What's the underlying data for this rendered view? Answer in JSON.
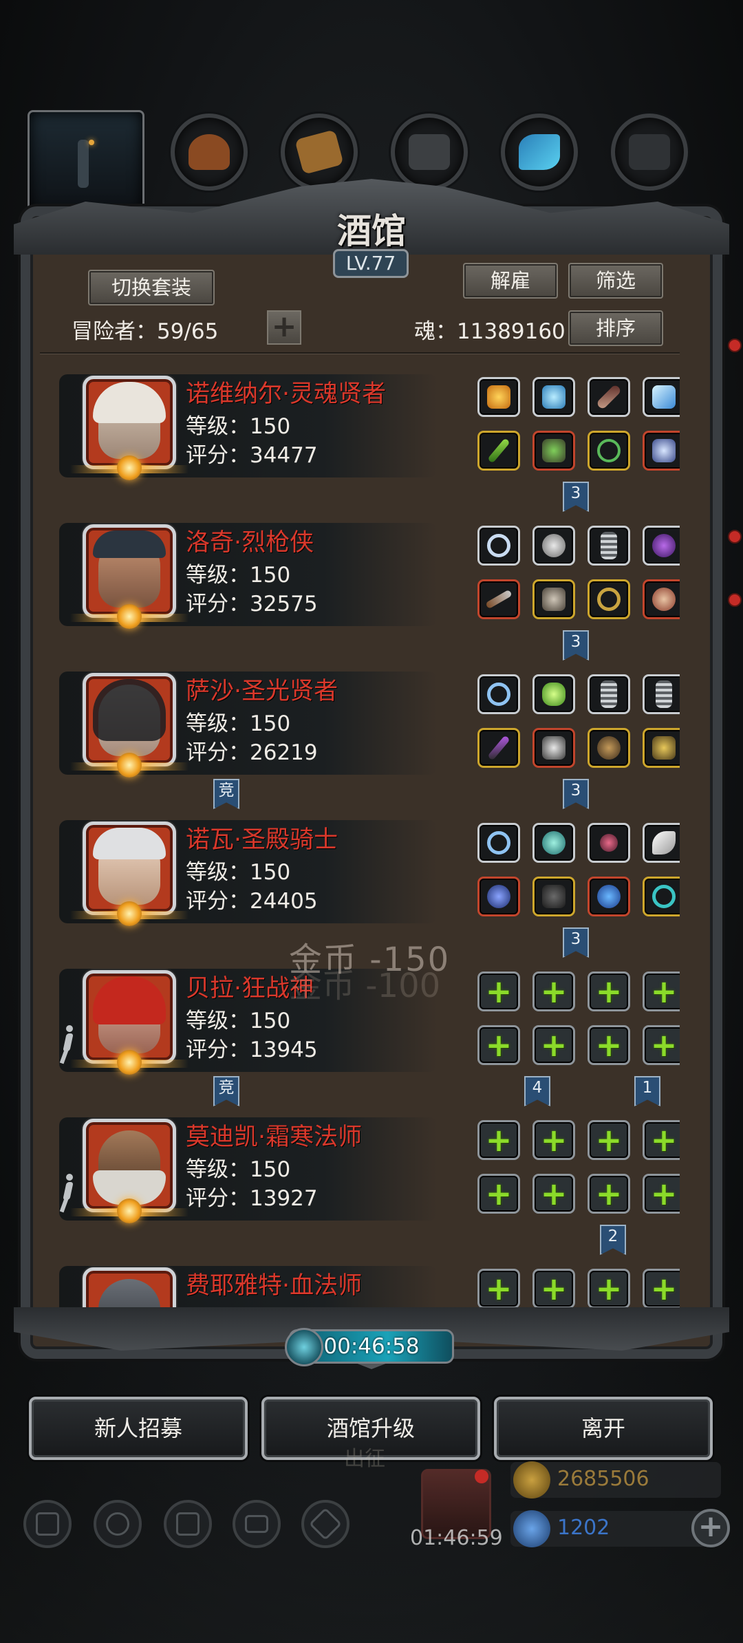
{
  "title": "酒馆",
  "level_badge": "LV.77",
  "buttons": {
    "switch_outfit": "切换套装",
    "dismiss": "解雇",
    "filter": "筛选",
    "sort": "排序",
    "recruit": "新人招募",
    "upgrade": "酒馆升级",
    "leave": "离开"
  },
  "adventurers": "冒险者：59/65",
  "plus": "+",
  "soul": "魂：11389160",
  "floating_text": "金币 -150",
  "floating_text_ghost": "金币 -100",
  "timer": "00:46:58",
  "heroes": [
    {
      "name": "诺维纳尔·灵魂贤者",
      "level": "等级：150",
      "score": "评分：34477"
    },
    {
      "name": "洛奇·烈枪侠",
      "level": "等级：150",
      "score": "评分：32575"
    },
    {
      "name": "萨沙·圣光贤者",
      "level": "等级：150",
      "score": "评分：26219"
    },
    {
      "name": "诺瓦·圣殿骑士",
      "level": "等级：150",
      "score": "评分：24405"
    },
    {
      "name": "贝拉·狂战神",
      "level": "等级：150",
      "score": "评分：13945"
    },
    {
      "name": "莫迪凯·霜寒法师",
      "level": "等级：150",
      "score": "评分：13927"
    },
    {
      "name": "费耶雅特·血法师",
      "level": "",
      "score": ""
    }
  ],
  "ribbons": {
    "r1": "3",
    "r2": "3",
    "r3a": "竞",
    "r3b": "3",
    "r4": "3",
    "r5a": "竞",
    "r5b": "4",
    "r5c": "1",
    "r6": "2"
  },
  "hud": {
    "gift_timer": "01:46:59",
    "gold": "2685506",
    "gems": "1202",
    "hidden_label": "出征"
  },
  "colors": {
    "hero_name": "#d9382b",
    "timer_bar": "#1aa2b8",
    "empty_slot_plus": "#8bdb2a",
    "gold_text": "#9a7a3a",
    "gem_text": "#3b74c8"
  }
}
